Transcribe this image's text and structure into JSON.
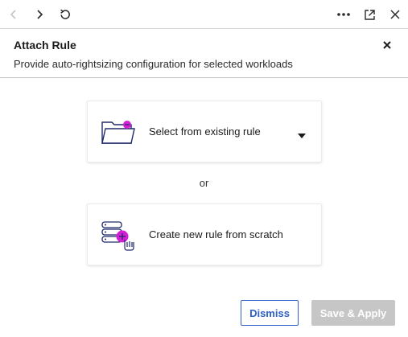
{
  "toolbar": {
    "back_icon": "chevron-left-icon",
    "forward_icon": "chevron-right-icon",
    "refresh_icon": "refresh-icon",
    "more_icon": "more-horizontal-icon",
    "popout_icon": "open-in-new-window-icon",
    "close_icon": "close-icon"
  },
  "dialog": {
    "title": "Attach Rule",
    "subtitle": "Provide auto-rightsizing configuration for selected workloads",
    "close_icon": "close-icon"
  },
  "options": {
    "existing": {
      "label": "Select from existing rule",
      "icon": "folder-icon",
      "dropdown_icon": "caret-down-icon"
    },
    "separator": "or",
    "new": {
      "label": "Create new rule from scratch",
      "icon": "server-add-icon"
    }
  },
  "footer": {
    "dismiss_label": "Dismiss",
    "apply_label": "Save & Apply",
    "apply_enabled": false
  },
  "colors": {
    "accent": "#2f5fc9",
    "magenta": "#d41fd4",
    "icon_navy": "#1e2a6b",
    "disabled_button": "#c6c6c6"
  }
}
